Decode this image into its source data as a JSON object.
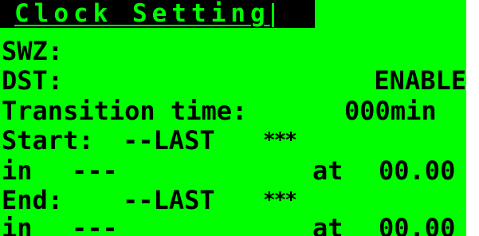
{
  "screen": {
    "title": "Clock Setting",
    "swz_label": "SWZ:",
    "swz_value": "",
    "dst_label": "DST:",
    "dst_value": "ENABLE",
    "transition_label": "Transition time:",
    "transition_value": "000min",
    "start_label": "Start:",
    "start_week": "--LAST",
    "start_day": "***",
    "start_month_prefix": "in",
    "start_month": "---",
    "start_at_label": "at",
    "start_time": "00.00",
    "end_label": "End:",
    "end_week": "--LAST",
    "end_day": "***",
    "end_month_prefix": "in",
    "end_month": "---",
    "end_at_label": "at",
    "end_time": "00.00"
  },
  "colors": {
    "background": "#00ff00",
    "text": "#000000",
    "title_bar": "#000000",
    "title_text": "#00ff00"
  }
}
